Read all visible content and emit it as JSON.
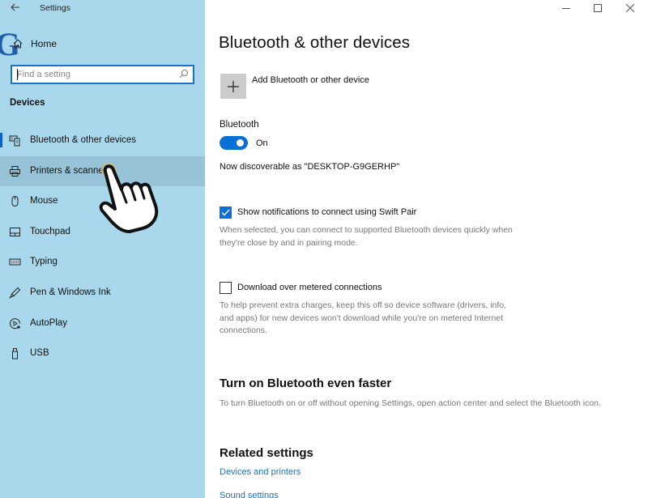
{
  "window": {
    "app_title": "Settings",
    "back_icon": "back-arrow-icon",
    "controls": [
      "minimize-icon",
      "maximize-icon",
      "close-icon"
    ]
  },
  "sidebar": {
    "home_label": "Home",
    "search": {
      "placeholder": "Find a setting",
      "value": ""
    },
    "section_title": "Devices",
    "items": [
      {
        "label": "Bluetooth & other devices",
        "icon": "bluetooth-devices-icon",
        "selected": true
      },
      {
        "label": "Printers & scanners",
        "icon": "printer-icon",
        "hovered": true
      },
      {
        "label": "Mouse",
        "icon": "mouse-icon"
      },
      {
        "label": "Touchpad",
        "icon": "touchpad-icon"
      },
      {
        "label": "Typing",
        "icon": "keyboard-icon"
      },
      {
        "label": "Pen & Windows Ink",
        "icon": "pen-icon"
      },
      {
        "label": "AutoPlay",
        "icon": "autoplay-icon"
      },
      {
        "label": "USB",
        "icon": "usb-icon"
      }
    ]
  },
  "main": {
    "title": "Bluetooth & other devices",
    "add_device_label": "Add Bluetooth or other device",
    "bluetooth": {
      "label": "Bluetooth",
      "toggle_on": true,
      "state_text": "On",
      "discoverable_text": "Now discoverable as \"DESKTOP-G9GERHP\""
    },
    "swift_pair": {
      "checked": true,
      "label": "Show notifications to connect using Swift Pair",
      "description": "When selected, you can connect to supported Bluetooth devices quickly when they're close by and in pairing mode."
    },
    "metered": {
      "checked": false,
      "label": "Download over metered connections",
      "description": "To help prevent extra charges, keep this off so device software (drivers, info, and apps) for new devices won't download while you're on metered Internet connections."
    },
    "faster": {
      "heading": "Turn on Bluetooth even faster",
      "description": "To turn Bluetooth on or off without opening Settings, open action center and select the Bluetooth icon."
    },
    "related": {
      "heading": "Related settings",
      "links": [
        "Devices and printers",
        "Sound settings"
      ]
    }
  },
  "colors": {
    "sidebar_bg": "#a9d8ec",
    "accent": "#0a6fd6",
    "link": "#1a73c9",
    "hover_bg": "#96c3d7"
  }
}
